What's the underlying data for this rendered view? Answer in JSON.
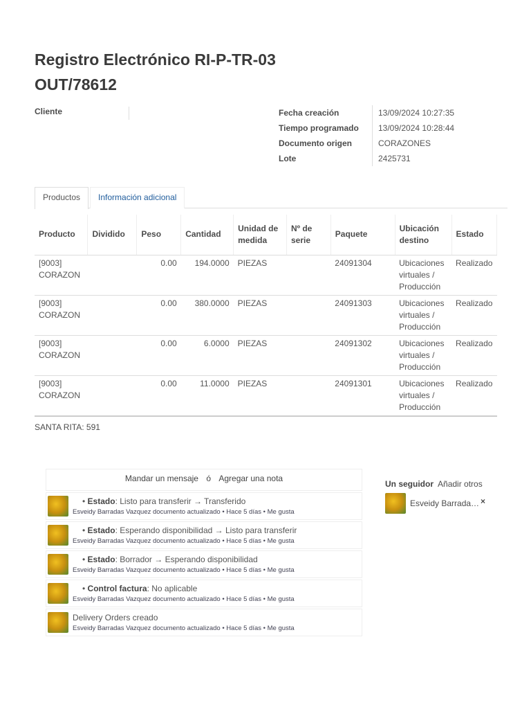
{
  "title": {
    "line1": "Registro Electrónico RI-P-TR-03",
    "line2": "OUT/78612"
  },
  "cliente_label": "Cliente",
  "info": [
    {
      "label": "Fecha creación",
      "value": "13/09/2024 10:27:35"
    },
    {
      "label": "Tiempo programado",
      "value": "13/09/2024 10:28:44"
    },
    {
      "label": "Documento origen",
      "value": "CORAZONES"
    },
    {
      "label": "Lote",
      "value": "2425731"
    }
  ],
  "tabs": [
    "Productos",
    "Información adicional"
  ],
  "table": {
    "headers": [
      "Producto",
      "Dividido",
      "Peso",
      "Cantidad",
      "Unidad de medida",
      "Nº de serie",
      "Paquete",
      "Ubicación destino",
      "Estado"
    ],
    "rows": [
      [
        "[9003] CORAZON",
        "",
        "0.00",
        "194.0000",
        "PIEZAS",
        "",
        "24091304",
        "Ubicaciones virtuales / Producción",
        "Realizado"
      ],
      [
        "[9003] CORAZON",
        "",
        "0.00",
        "380.0000",
        "PIEZAS",
        "",
        "24091303",
        "Ubicaciones virtuales / Producción",
        "Realizado"
      ],
      [
        "[9003] CORAZON",
        "",
        "0.00",
        "6.0000",
        "PIEZAS",
        "",
        "24091302",
        "Ubicaciones virtuales / Producción",
        "Realizado"
      ],
      [
        "[9003] CORAZON",
        "",
        "0.00",
        "11.0000",
        "PIEZAS",
        "",
        "24091301",
        "Ubicaciones virtuales / Producción",
        "Realizado"
      ]
    ]
  },
  "footer_note": "SANTA RITA: 591",
  "chatter": {
    "send": "Mandar un mensaje",
    "sep": "ó",
    "note": "Agregar una nota",
    "messages": [
      {
        "field": "Estado",
        "text": ": Listo para transferir → Transferido",
        "meta": "Esveidy Barradas Vazquez documento actualizado • Hace 5 días • Me gusta"
      },
      {
        "field": "Estado",
        "text": ": Esperando disponibilidad → Listo para transferir",
        "meta": "Esveidy Barradas Vazquez documento actualizado • Hace 5 días • Me gusta"
      },
      {
        "field": "Estado",
        "text": ": Borrador → Esperando disponibilidad",
        "meta": "Esveidy Barradas Vazquez documento actualizado • Hace 5 días • Me gusta"
      },
      {
        "field": "Control factura",
        "text": ": No aplicable",
        "meta": "Esveidy Barradas Vazquez documento actualizado • Hace 5 días • Me gusta"
      },
      {
        "field": "",
        "text": "Delivery Orders creado",
        "meta": "Esveidy Barradas Vazquez documento actualizado • Hace 5 días • Me gusta"
      }
    ]
  },
  "followers": {
    "count_label": "Un seguidor",
    "add": "Añadir otros",
    "name": "Esveidy Barrada…",
    "remove": "×"
  }
}
